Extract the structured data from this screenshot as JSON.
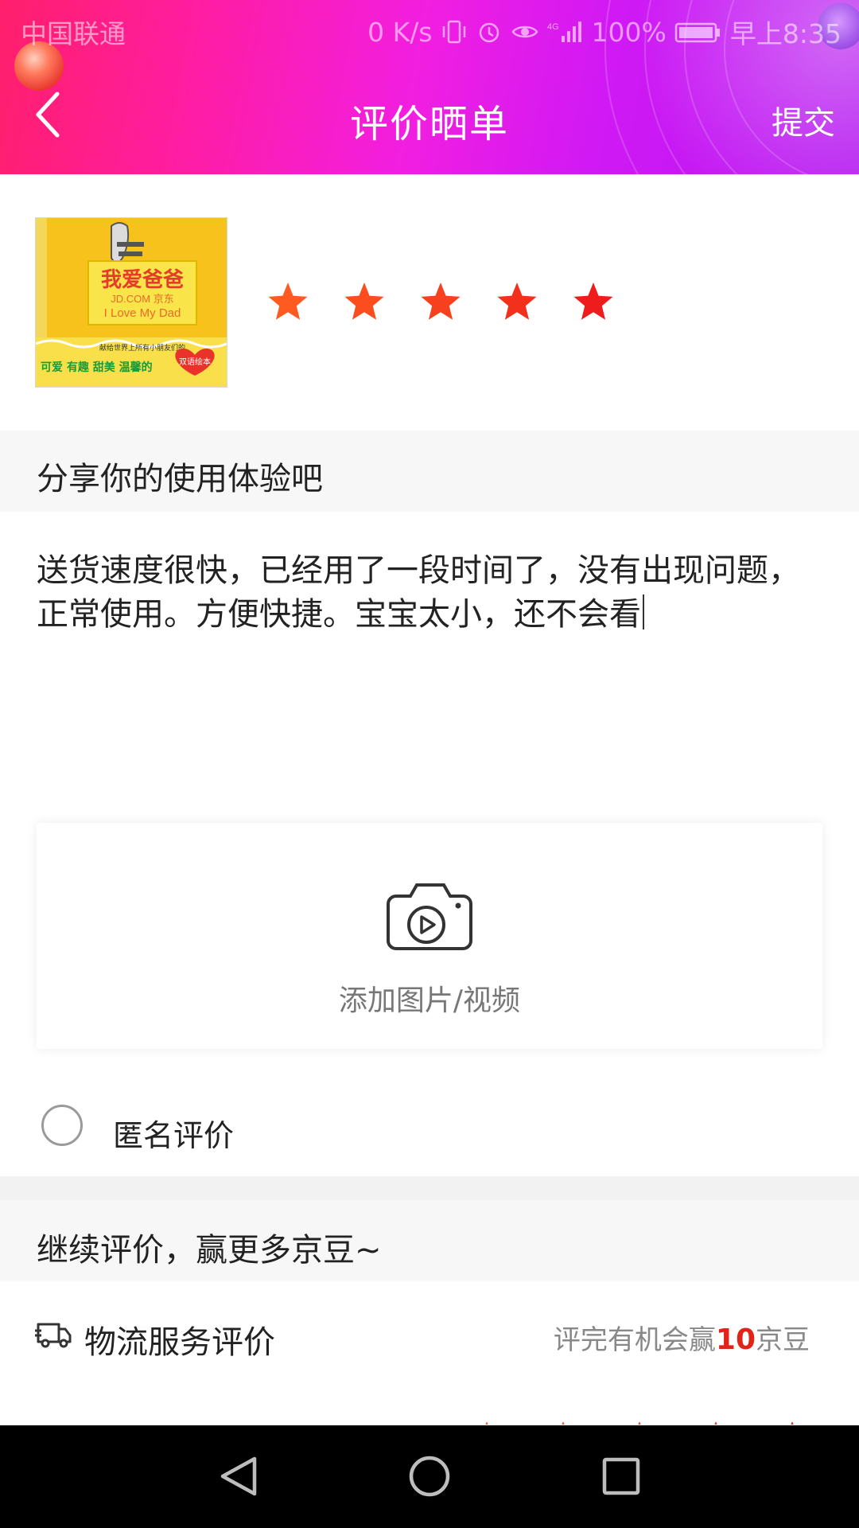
{
  "status_bar": {
    "carrier": "中国联通",
    "net_speed": "0 K/s",
    "battery": "100%",
    "time": "早上8:35"
  },
  "nav": {
    "title": "评价晒单",
    "submit_label": "提交"
  },
  "product": {
    "thumb_title": "我爱爸爸",
    "thumb_subtitle": "I Love My Dad",
    "thumb_tagline": "可爱 有趣 甜美 温馨的",
    "thumb_badge": "双语绘本",
    "thumb_top_text": "献给世界上所有小朋友们的",
    "watermark": "JD.COM 京东",
    "rating": 5
  },
  "share_section": {
    "heading": "分享你的使用体验吧",
    "review_text": "送货速度很快，已经用了一段时间了，没有出现问题，正常使用。方便快捷。宝宝太小，还不会看"
  },
  "upload": {
    "label": "添加图片/视频"
  },
  "anonymous": {
    "label": "匿名评价",
    "checked": false
  },
  "continue_section": {
    "heading": "继续评价，赢更多京豆~"
  },
  "logistics": {
    "label": "物流服务评价",
    "hint_prefix": "评完有机会赢",
    "hint_number": "10",
    "hint_suffix": "京豆"
  },
  "colors": {
    "star_orange": "#ff5a1f",
    "star_red": "#ee1c1c",
    "accent_red": "#e2231a",
    "header_pink": "#ff1f6b",
    "header_purple": "#c21cf0"
  },
  "icons": {
    "back": "chevron-left-icon",
    "camera": "camera-video-icon",
    "truck": "truck-icon",
    "nav_back": "triangle-back-icon",
    "nav_home": "circle-home-icon",
    "nav_recent": "square-recent-icon"
  }
}
